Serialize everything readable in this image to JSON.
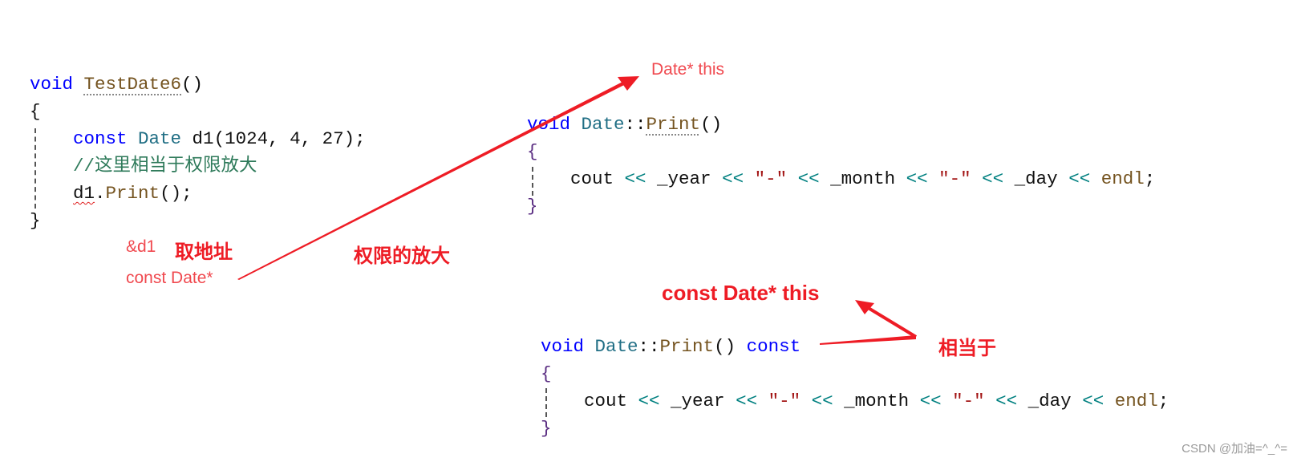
{
  "code_blocks": [
    {
      "id": "testdate6",
      "lines": [
        [
          {
            "t": "void ",
            "k": "kw"
          },
          {
            "t": "TestDate6",
            "k": "fn dots"
          },
          {
            "t": "()",
            "k": "pn"
          }
        ],
        [
          {
            "t": "{",
            "k": "pn"
          }
        ],
        [
          {
            "t": "    const ",
            "k": "kw"
          },
          {
            "t": "Date ",
            "k": "ty"
          },
          {
            "t": "d1",
            "k": "id"
          },
          {
            "t": "(1024, 4, 27);",
            "k": "pn"
          }
        ],
        [
          {
            "t": "    //这里相当于权限放大",
            "k": "cm"
          }
        ],
        [
          {
            "t": "    ",
            "k": "pn"
          },
          {
            "t": "d1",
            "k": "id squig"
          },
          {
            "t": ".",
            "k": "pn"
          },
          {
            "t": "Print",
            "k": "fn"
          },
          {
            "t": "();",
            "k": "pn"
          }
        ],
        [
          {
            "t": "}",
            "k": "pn"
          }
        ]
      ]
    },
    {
      "id": "print",
      "lines": [
        [
          {
            "t": "void ",
            "k": "kw"
          },
          {
            "t": "Date",
            "k": "ty"
          },
          {
            "t": "::",
            "k": "pn"
          },
          {
            "t": "Print",
            "k": "fn dots"
          },
          {
            "t": "()",
            "k": "pn"
          }
        ],
        [
          {
            "t": "{",
            "k": "br"
          }
        ],
        [
          {
            "t": "    cout ",
            "k": "id"
          },
          {
            "t": "<< ",
            "k": "op"
          },
          {
            "t": "_year ",
            "k": "id"
          },
          {
            "t": "<< ",
            "k": "op"
          },
          {
            "t": "\"-\" ",
            "k": "st"
          },
          {
            "t": "<< ",
            "k": "op"
          },
          {
            "t": "_month ",
            "k": "id"
          },
          {
            "t": "<< ",
            "k": "op"
          },
          {
            "t": "\"-\" ",
            "k": "st"
          },
          {
            "t": "<< ",
            "k": "op"
          },
          {
            "t": "_day ",
            "k": "id"
          },
          {
            "t": "<< ",
            "k": "op"
          },
          {
            "t": "endl",
            "k": "fn"
          },
          {
            "t": ";",
            "k": "pn"
          }
        ],
        [
          {
            "t": "}",
            "k": "br"
          }
        ]
      ]
    },
    {
      "id": "print-const",
      "lines": [
        [
          {
            "t": "void ",
            "k": "kw"
          },
          {
            "t": "Date",
            "k": "ty"
          },
          {
            "t": "::",
            "k": "pn"
          },
          {
            "t": "Print",
            "k": "fn"
          },
          {
            "t": "() ",
            "k": "pn"
          },
          {
            "t": "const",
            "k": "kw"
          }
        ],
        [
          {
            "t": "{",
            "k": "br"
          }
        ],
        [
          {
            "t": "    cout ",
            "k": "id"
          },
          {
            "t": "<< ",
            "k": "op"
          },
          {
            "t": "_year ",
            "k": "id"
          },
          {
            "t": "<< ",
            "k": "op"
          },
          {
            "t": "\"-\" ",
            "k": "st"
          },
          {
            "t": "<< ",
            "k": "op"
          },
          {
            "t": "_month ",
            "k": "id"
          },
          {
            "t": "<< ",
            "k": "op"
          },
          {
            "t": "\"-\" ",
            "k": "st"
          },
          {
            "t": "<< ",
            "k": "op"
          },
          {
            "t": "_day ",
            "k": "id"
          },
          {
            "t": "<< ",
            "k": "op"
          },
          {
            "t": "endl",
            "k": "fn"
          },
          {
            "t": ";",
            "k": "pn"
          }
        ],
        [
          {
            "t": "}",
            "k": "br"
          }
        ]
      ]
    }
  ],
  "annotations": {
    "date_this": "Date* this",
    "addr_d1": "&d1",
    "take_address": "取地址",
    "const_date_ptr": "const Date*",
    "permission_amplify": "权限的放大",
    "const_date_this": "const Date* this",
    "equivalent": "相当于"
  },
  "watermark": "CSDN @加油=^_^=",
  "colors": {
    "annotation": "#ee1c25",
    "keyword": "#0000ff",
    "string": "#a31515"
  }
}
